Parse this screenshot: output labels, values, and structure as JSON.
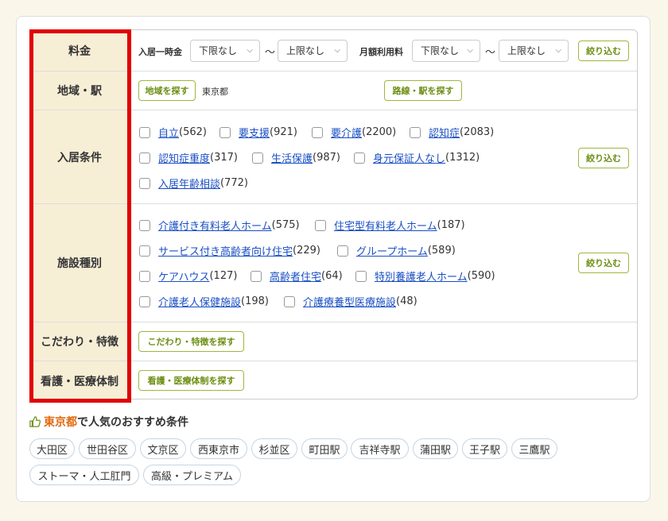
{
  "rows": {
    "price": {
      "label": "料金",
      "entry_fee_label": "入居一時金",
      "entry_min": "下限なし",
      "entry_max": "上限なし",
      "monthly_label": "月額利用料",
      "monthly_min": "下限なし",
      "monthly_max": "上限なし",
      "tilde": "〜",
      "button": "絞り込む"
    },
    "area": {
      "label": "地域・駅",
      "area_button": "地域を探す",
      "area_value": "東京都",
      "line_button": "路線・駅を探す"
    },
    "conditions": {
      "label": "入居条件",
      "button": "絞り込む",
      "items": [
        {
          "name": "自立",
          "count": "(562)"
        },
        {
          "name": "要支援",
          "count": "(921)"
        },
        {
          "name": "要介護",
          "count": "(2200)"
        },
        {
          "name": "認知症",
          "count": "(2083)"
        },
        {
          "name": "認知症重度",
          "count": "(317)"
        },
        {
          "name": "生活保護",
          "count": "(987)"
        },
        {
          "name": "身元保証人なし",
          "count": "(1312)"
        },
        {
          "name": "入居年齢相談",
          "count": "(772)"
        }
      ]
    },
    "facility": {
      "label": "施設種別",
      "button": "絞り込む",
      "items": [
        {
          "name": "介護付き有料老人ホーム",
          "count": "(575)"
        },
        {
          "name": "住宅型有料老人ホーム",
          "count": "(187)"
        },
        {
          "name": "サービス付き高齢者向け住宅",
          "count": "(229)"
        },
        {
          "name": "グループホーム",
          "count": "(589)"
        },
        {
          "name": "ケアハウス",
          "count": "(127)"
        },
        {
          "name": "高齢者住宅",
          "count": "(64)"
        },
        {
          "name": "特別養護老人ホーム",
          "count": "(590)"
        },
        {
          "name": "介護老人保健施設",
          "count": "(198)"
        },
        {
          "name": "介護療養型医療施設",
          "count": "(48)"
        }
      ]
    },
    "features": {
      "label": "こだわり・特徴",
      "button": "こだわり・特徴を探す"
    },
    "medical": {
      "label": "看護・医療体制",
      "button": "看護・医療体制を探す"
    }
  },
  "popular": {
    "location": "東京都",
    "suffix": "で人気のおすすめ条件",
    "tags": [
      "大田区",
      "世田谷区",
      "文京区",
      "西東京市",
      "杉並区",
      "町田駅",
      "吉祥寺駅",
      "蒲田駅",
      "王子駅",
      "三鷹駅",
      "ストーマ・人工肛門",
      "高級・プレミアム"
    ]
  },
  "colors": {
    "highlight": "#e00000",
    "header_bg": "#f7eed6",
    "green": "#6d8f14",
    "link": "#1a4fc4",
    "location": "#e06a10"
  }
}
